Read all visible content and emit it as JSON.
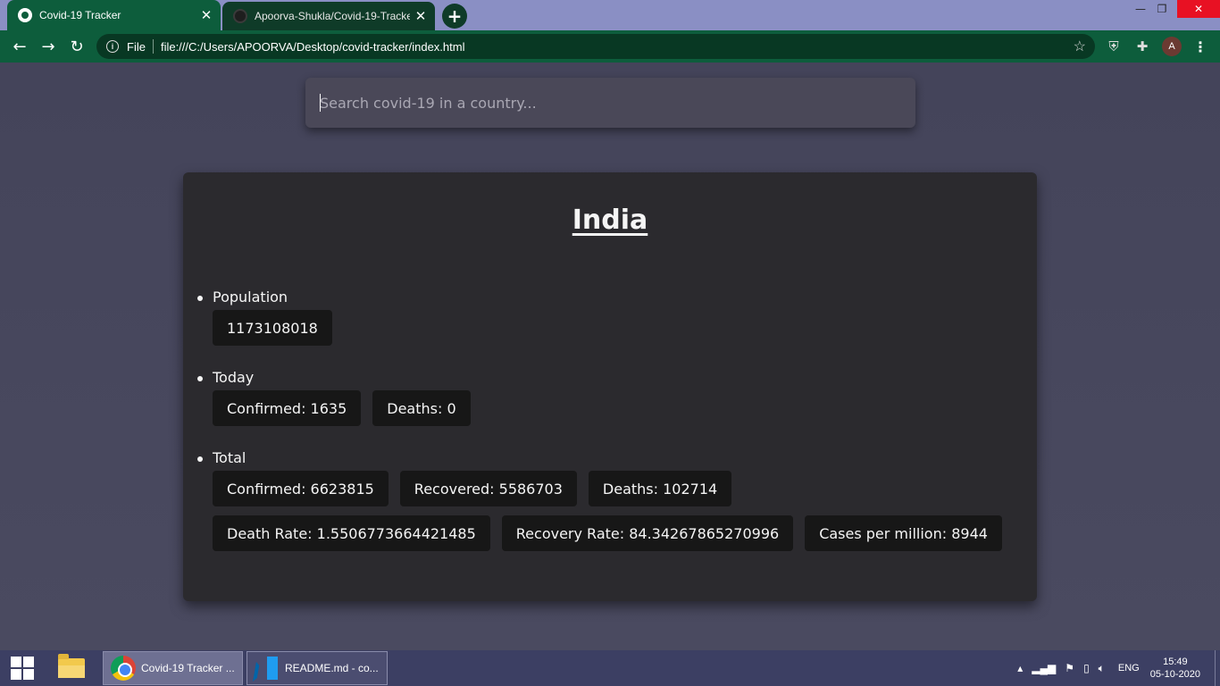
{
  "browser": {
    "tabs": [
      {
        "title": "Covid-19 Tracker",
        "active": true
      },
      {
        "title": "Apoorva-Shukla/Covid-19-Tracker",
        "active": false
      }
    ],
    "address": {
      "scheme_label": "File",
      "url": "file:///C:/Users/APOORVA/Desktop/covid-tracker/index.html"
    },
    "profile_initial": "A",
    "theme_color": "#0d5d3c"
  },
  "search": {
    "placeholder": "Search covid-19 in a country..."
  },
  "country": {
    "name": "India",
    "population_label": "Population",
    "population": "1173108018",
    "today_label": "Today",
    "today": {
      "confirmed": "Confirmed: 1635",
      "deaths": "Deaths: 0"
    },
    "total_label": "Total",
    "total": {
      "confirmed": "Confirmed: 6623815",
      "recovered": "Recovered: 5586703",
      "deaths": "Deaths: 102714",
      "death_rate": "Death Rate: 1.5506773664421485",
      "recovery_rate": "Recovery Rate: 84.34267865270996",
      "cases_per_million": "Cases per million: 8944"
    }
  },
  "taskbar": {
    "items": [
      {
        "label": "Covid-19 Tracker ...",
        "icon": "chrome-icon"
      },
      {
        "label": "README.md - co...",
        "icon": "vscode-icon"
      }
    ],
    "language": "ENG",
    "time": "15:49",
    "date": "05-10-2020"
  }
}
